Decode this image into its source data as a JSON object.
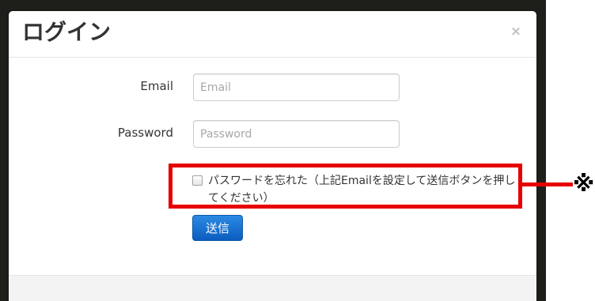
{
  "modal": {
    "title": "ログイン",
    "close_glyph": "×"
  },
  "form": {
    "email": {
      "label": "Email",
      "placeholder": "Email",
      "value": ""
    },
    "password": {
      "label": "Password",
      "placeholder": "Password",
      "value": ""
    },
    "forgot_password": {
      "label": "パスワードを忘れた（上記Emailを設定して送信ボタンを押してください）",
      "checked": false
    },
    "submit_label": "送信"
  },
  "annotation": {
    "mark": "※",
    "color": "#e60000"
  },
  "colors": {
    "primary": "#0c5cbf",
    "text": "#333333",
    "placeholder": "#a7a7a7"
  }
}
